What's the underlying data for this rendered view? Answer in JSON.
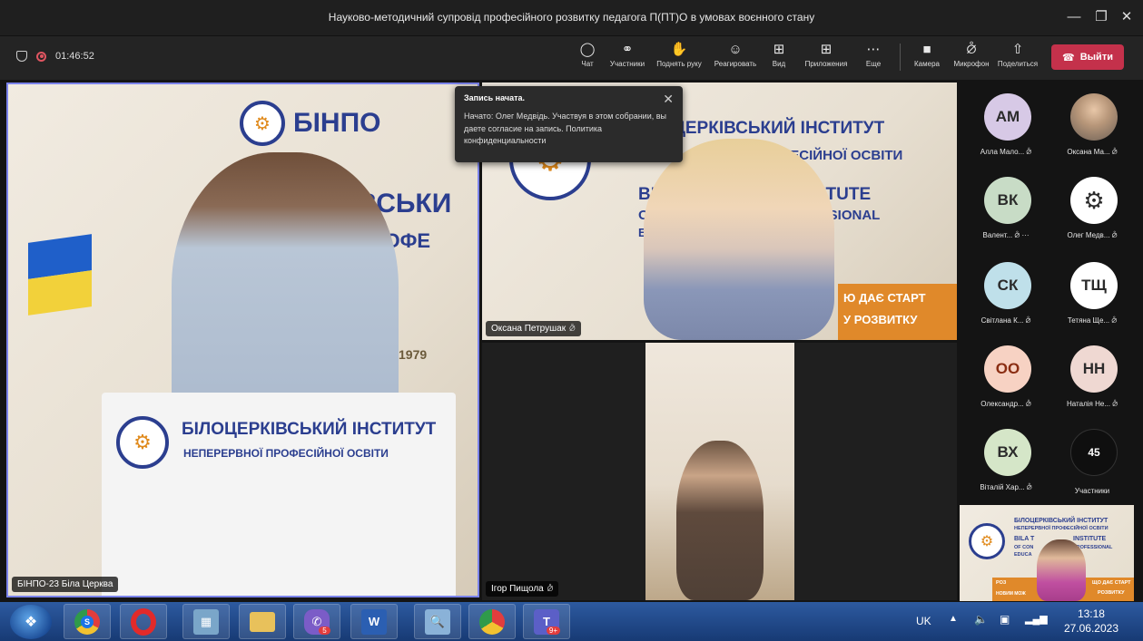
{
  "window": {
    "title": "Науково-методичний супровід професійного розвитку педагога П(ПТ)О в умовах воєнного стану",
    "minimize": "—",
    "maximize": "❐",
    "close": "✕"
  },
  "toolbar": {
    "elapsed": "01:46:52",
    "buttons": {
      "chat": {
        "label": "Чат",
        "icon": "chat-icon"
      },
      "participants": {
        "label": "Участники",
        "icon": "people-icon"
      },
      "raise_hand": {
        "label": "Поднять руку",
        "icon": "hand-icon"
      },
      "react": {
        "label": "Реагировать",
        "icon": "smile-icon"
      },
      "view": {
        "label": "Вид",
        "icon": "grid-icon"
      },
      "apps": {
        "label": "Приложения",
        "icon": "plus-icon"
      },
      "more": {
        "label": "Еще",
        "icon": "more-icon"
      },
      "camera": {
        "label": "Камера",
        "icon": "camera-icon"
      },
      "mic": {
        "label": "Микрофон",
        "icon": "mic-off-icon"
      },
      "share": {
        "label": "Поделиться",
        "icon": "share-icon"
      }
    },
    "leave_label": "Выйти",
    "leave_color": "#c4314b"
  },
  "notice": {
    "heading": "Запись начата.",
    "body": "Начато: Олег Медвідь. Участвуя в этом собрании, вы даете согласие на запись. Политика конфиденциальности"
  },
  "videos": {
    "main": {
      "name": "БІНПО-23 Біла Церква",
      "banner_top": "БІНПО",
      "banner_mid": "ЕРКІВСЬКИ",
      "banner_mid2": "ОЇ ПРОФЕ",
      "podium_line1": "БІЛОЦЕРКІВСЬКИЙ ІНСТИТУТ",
      "podium_line2": "НЕПЕРЕРВНОЇ ПРОФЕСІЙНОЇ ОСВІТИ",
      "year": "1979"
    },
    "top_right": {
      "name": "Оксана Петрушак",
      "banner_line1": "ЦЕРКІВСЬКИЙ ІНСТИТУТ",
      "banner_line2": "РОФЕСІЙНОЇ ОСВІТИ",
      "banner_en1": "BIL",
      "banner_en1b": "INSTITUTE",
      "banner_en2": "OF",
      "banner_en2b": "ROFESSIONAL",
      "banner_en3": "ED",
      "slogan1": "Ю ДАЄ СТАРТ",
      "slogan2": "У РОЗВИТКУ"
    },
    "bottom": {
      "name": "Ігор Пищола"
    }
  },
  "participants": [
    {
      "initials": "АМ",
      "name": "Алла Мало...",
      "color": "#d7c9e6",
      "text": "#2b2b2b",
      "photo": false
    },
    {
      "initials": "",
      "name": "Оксана Ма...",
      "color": "#c9b79a",
      "text": "#2b2b2b",
      "photo": true
    },
    {
      "initials": "ВК",
      "name": "Валент...",
      "color": "#c8dcc6",
      "text": "#2b2b2b",
      "photo": false,
      "more": "···"
    },
    {
      "initials": "",
      "name": "Олег Медв...",
      "color": "#ffffff",
      "text": "#2b2b2b",
      "photo": false,
      "logo": true
    },
    {
      "initials": "СК",
      "name": "Світлана К...",
      "color": "#bfe0ea",
      "text": "#2b2b2b",
      "photo": false
    },
    {
      "initials": "ТЩ",
      "name": "Тетяна Ще...",
      "color": "#ffffff",
      "text": "#2b2b2b",
      "photo": false
    },
    {
      "initials": "ОО",
      "name": "Олександр...",
      "color": "#f7d2c3",
      "text": "#8a2d12",
      "photo": false
    },
    {
      "initials": "НН",
      "name": "Наталія Не...",
      "color": "#efd8d2",
      "text": "#2b2b2b",
      "photo": false
    },
    {
      "initials": "ВХ",
      "name": "Віталій Хар...",
      "color": "#d5e6c8",
      "text": "#2b2b2b",
      "photo": false
    }
  ],
  "overflow": {
    "count": "45",
    "label": "Участники"
  },
  "selfview": {
    "line1": "БІЛОЦЕРКІВСЬКИЙ ІНСТИТУТ",
    "line2": "НЕПЕРЕРВНОЇ ПРОФЕСІЙНОЇ ОСВІТИ",
    "line3": "BILA T",
    "line3b": "INSTITUTE",
    "line4": "OF CON",
    "line4b": "PROFESSIONAL",
    "line5": "EDUCA",
    "slogan1": "ЩО ДАЄ СТАРТ",
    "slogan2": "РОЗВИТКУ",
    "left1": "РОЗ",
    "left2": "НОВИМ МОЖ"
  },
  "taskbar": {
    "apps": [
      {
        "icon": "chrome-icon",
        "color": "#2f9a4b",
        "label": "S"
      },
      {
        "icon": "opera-icon",
        "color": "#e22a2a",
        "label": ""
      },
      {
        "icon": "calculator-icon",
        "color": "#7aa6c9",
        "label": ""
      },
      {
        "icon": "folder-icon",
        "color": "#e8c15b",
        "label": ""
      },
      {
        "icon": "viber-icon",
        "color": "#7b5cc7",
        "label": "",
        "badge": "5"
      },
      {
        "icon": "word-icon",
        "color": "#2b5fb2",
        "label": "W"
      },
      {
        "icon": "search-tool-icon",
        "color": "#8ab2d8",
        "label": ""
      },
      {
        "icon": "chrome-icon",
        "color": "#2f9a4b",
        "label": ""
      },
      {
        "icon": "teams-icon",
        "color": "#5b5fc7",
        "label": "T",
        "badge": "9+"
      }
    ],
    "lang": "UK",
    "time": "13:18",
    "date": "27.06.2023"
  }
}
